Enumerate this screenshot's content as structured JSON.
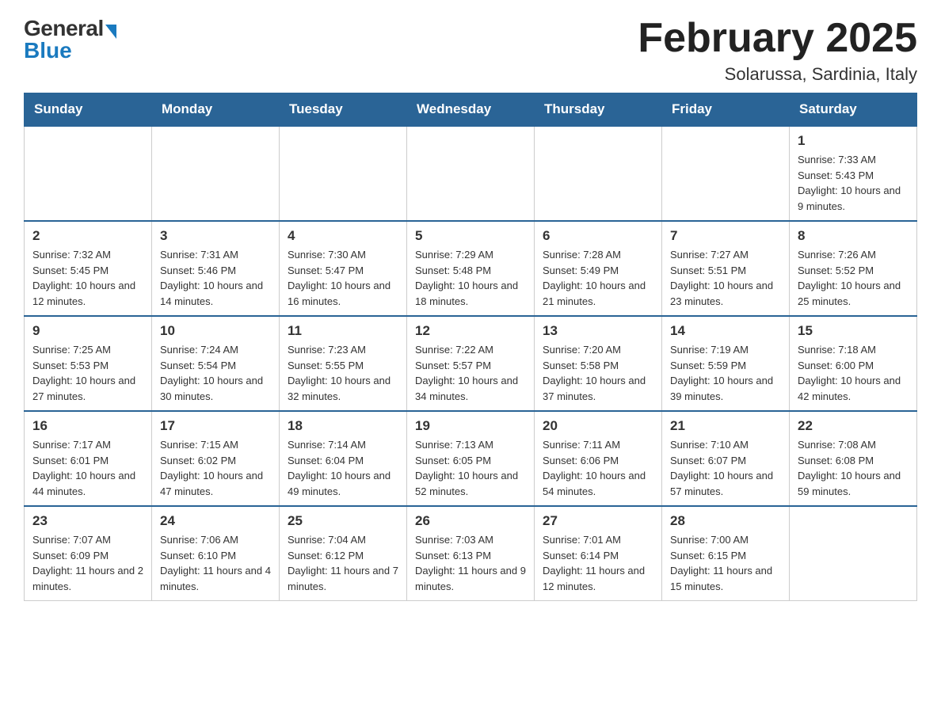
{
  "logo": {
    "general": "General",
    "blue": "Blue"
  },
  "title": "February 2025",
  "location": "Solarussa, Sardinia, Italy",
  "weekdays": [
    "Sunday",
    "Monday",
    "Tuesday",
    "Wednesday",
    "Thursday",
    "Friday",
    "Saturday"
  ],
  "weeks": [
    [
      {
        "day": "",
        "info": ""
      },
      {
        "day": "",
        "info": ""
      },
      {
        "day": "",
        "info": ""
      },
      {
        "day": "",
        "info": ""
      },
      {
        "day": "",
        "info": ""
      },
      {
        "day": "",
        "info": ""
      },
      {
        "day": "1",
        "info": "Sunrise: 7:33 AM\nSunset: 5:43 PM\nDaylight: 10 hours and 9 minutes."
      }
    ],
    [
      {
        "day": "2",
        "info": "Sunrise: 7:32 AM\nSunset: 5:45 PM\nDaylight: 10 hours and 12 minutes."
      },
      {
        "day": "3",
        "info": "Sunrise: 7:31 AM\nSunset: 5:46 PM\nDaylight: 10 hours and 14 minutes."
      },
      {
        "day": "4",
        "info": "Sunrise: 7:30 AM\nSunset: 5:47 PM\nDaylight: 10 hours and 16 minutes."
      },
      {
        "day": "5",
        "info": "Sunrise: 7:29 AM\nSunset: 5:48 PM\nDaylight: 10 hours and 18 minutes."
      },
      {
        "day": "6",
        "info": "Sunrise: 7:28 AM\nSunset: 5:49 PM\nDaylight: 10 hours and 21 minutes."
      },
      {
        "day": "7",
        "info": "Sunrise: 7:27 AM\nSunset: 5:51 PM\nDaylight: 10 hours and 23 minutes."
      },
      {
        "day": "8",
        "info": "Sunrise: 7:26 AM\nSunset: 5:52 PM\nDaylight: 10 hours and 25 minutes."
      }
    ],
    [
      {
        "day": "9",
        "info": "Sunrise: 7:25 AM\nSunset: 5:53 PM\nDaylight: 10 hours and 27 minutes."
      },
      {
        "day": "10",
        "info": "Sunrise: 7:24 AM\nSunset: 5:54 PM\nDaylight: 10 hours and 30 minutes."
      },
      {
        "day": "11",
        "info": "Sunrise: 7:23 AM\nSunset: 5:55 PM\nDaylight: 10 hours and 32 minutes."
      },
      {
        "day": "12",
        "info": "Sunrise: 7:22 AM\nSunset: 5:57 PM\nDaylight: 10 hours and 34 minutes."
      },
      {
        "day": "13",
        "info": "Sunrise: 7:20 AM\nSunset: 5:58 PM\nDaylight: 10 hours and 37 minutes."
      },
      {
        "day": "14",
        "info": "Sunrise: 7:19 AM\nSunset: 5:59 PM\nDaylight: 10 hours and 39 minutes."
      },
      {
        "day": "15",
        "info": "Sunrise: 7:18 AM\nSunset: 6:00 PM\nDaylight: 10 hours and 42 minutes."
      }
    ],
    [
      {
        "day": "16",
        "info": "Sunrise: 7:17 AM\nSunset: 6:01 PM\nDaylight: 10 hours and 44 minutes."
      },
      {
        "day": "17",
        "info": "Sunrise: 7:15 AM\nSunset: 6:02 PM\nDaylight: 10 hours and 47 minutes."
      },
      {
        "day": "18",
        "info": "Sunrise: 7:14 AM\nSunset: 6:04 PM\nDaylight: 10 hours and 49 minutes."
      },
      {
        "day": "19",
        "info": "Sunrise: 7:13 AM\nSunset: 6:05 PM\nDaylight: 10 hours and 52 minutes."
      },
      {
        "day": "20",
        "info": "Sunrise: 7:11 AM\nSunset: 6:06 PM\nDaylight: 10 hours and 54 minutes."
      },
      {
        "day": "21",
        "info": "Sunrise: 7:10 AM\nSunset: 6:07 PM\nDaylight: 10 hours and 57 minutes."
      },
      {
        "day": "22",
        "info": "Sunrise: 7:08 AM\nSunset: 6:08 PM\nDaylight: 10 hours and 59 minutes."
      }
    ],
    [
      {
        "day": "23",
        "info": "Sunrise: 7:07 AM\nSunset: 6:09 PM\nDaylight: 11 hours and 2 minutes."
      },
      {
        "day": "24",
        "info": "Sunrise: 7:06 AM\nSunset: 6:10 PM\nDaylight: 11 hours and 4 minutes."
      },
      {
        "day": "25",
        "info": "Sunrise: 7:04 AM\nSunset: 6:12 PM\nDaylight: 11 hours and 7 minutes."
      },
      {
        "day": "26",
        "info": "Sunrise: 7:03 AM\nSunset: 6:13 PM\nDaylight: 11 hours and 9 minutes."
      },
      {
        "day": "27",
        "info": "Sunrise: 7:01 AM\nSunset: 6:14 PM\nDaylight: 11 hours and 12 minutes."
      },
      {
        "day": "28",
        "info": "Sunrise: 7:00 AM\nSunset: 6:15 PM\nDaylight: 11 hours and 15 minutes."
      },
      {
        "day": "",
        "info": ""
      }
    ]
  ]
}
